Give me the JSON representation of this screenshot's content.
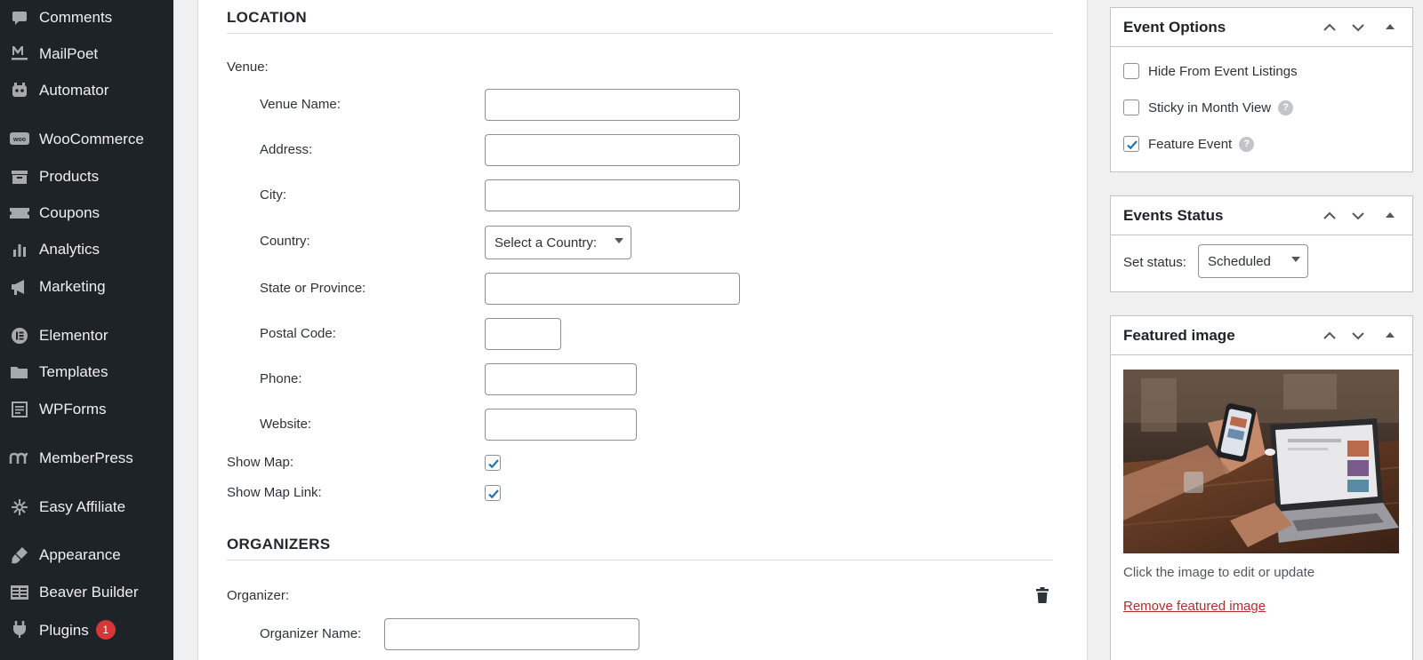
{
  "sidebar": {
    "items": [
      {
        "label": "Comments",
        "icon": "comments-icon"
      },
      {
        "label": "MailPoet",
        "icon": "mailpoet-icon"
      },
      {
        "label": "Automator",
        "icon": "automator-icon"
      },
      {
        "label": "WooCommerce",
        "icon": "woocommerce-icon"
      },
      {
        "label": "Products",
        "icon": "products-icon"
      },
      {
        "label": "Coupons",
        "icon": "coupons-icon"
      },
      {
        "label": "Analytics",
        "icon": "analytics-icon"
      },
      {
        "label": "Marketing",
        "icon": "marketing-icon"
      },
      {
        "label": "Elementor",
        "icon": "elementor-icon"
      },
      {
        "label": "Templates",
        "icon": "templates-icon"
      },
      {
        "label": "WPForms",
        "icon": "wpforms-icon"
      },
      {
        "label": "MemberPress",
        "icon": "memberpress-icon"
      },
      {
        "label": "Easy Affiliate",
        "icon": "easy-affiliate-icon"
      },
      {
        "label": "Appearance",
        "icon": "appearance-icon"
      },
      {
        "label": "Beaver Builder",
        "icon": "beaver-builder-icon"
      },
      {
        "label": "Plugins",
        "icon": "plugins-icon",
        "badge": "1"
      }
    ]
  },
  "location": {
    "title": "LOCATION",
    "venue_label": "Venue:",
    "venue_name_label": "Venue Name:",
    "address_label": "Address:",
    "city_label": "City:",
    "country_label": "Country:",
    "country_select": "Select a Country:",
    "state_label": "State or Province:",
    "postal_label": "Postal Code:",
    "phone_label": "Phone:",
    "website_label": "Website:",
    "show_map_label": "Show Map:",
    "show_map_checked": true,
    "show_map_link_label": "Show Map Link:",
    "show_map_link_checked": true
  },
  "organizers": {
    "title": "ORGANIZERS",
    "organizer_label": "Organizer:",
    "organizer_name_label": "Organizer Name:"
  },
  "event_options": {
    "title": "Event Options",
    "hide_label": "Hide From Event Listings",
    "hide_checked": false,
    "sticky_label": "Sticky in Month View",
    "sticky_checked": false,
    "feature_label": "Feature Event",
    "feature_checked": true
  },
  "events_status": {
    "title": "Events Status",
    "set_status_label": "Set status:",
    "status_value": "Scheduled"
  },
  "featured_image": {
    "title": "Featured image",
    "hint": "Click the image to edit or update",
    "remove_link": "Remove featured image"
  },
  "colors": {
    "sidebar_bg": "#1d2327",
    "badge": "#d63638",
    "check": "#2271b1",
    "remove_link": "#b32d2e"
  }
}
